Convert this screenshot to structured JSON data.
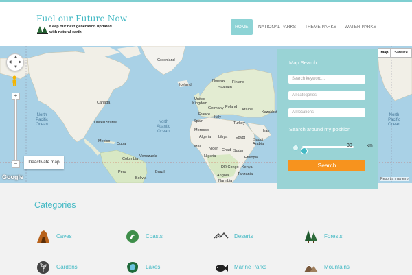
{
  "header": {
    "logo_title": "Fuel our Future Now",
    "tagline": "Keep our next generation updated with natural earth"
  },
  "nav": {
    "items": [
      {
        "label": "HOME",
        "active": true
      },
      {
        "label": "NATIONAL PARKS",
        "active": false
      },
      {
        "label": "THEME PARKS",
        "active": false
      },
      {
        "label": "WATER PARKS",
        "active": false
      }
    ]
  },
  "map": {
    "map_type_buttons": [
      "Map",
      "Satellite"
    ],
    "deactivate_label": "Deactivate map",
    "google_label": "Google",
    "report_label": "Report a map error",
    "labels": {
      "greenland": "Greenland",
      "iceland": "Iceland",
      "canada": "Canada",
      "united_states": "United States",
      "mexico": "Mexico",
      "cuba": "Cuba",
      "venezuela": "Venezuela",
      "colombia": "Colombia",
      "peru": "Peru",
      "brazil": "Brazil",
      "bolivia": "Bolivia",
      "norway": "Norway",
      "sweden": "Sweden",
      "finland": "Finland",
      "united_kingdom": "United Kingdom",
      "germany": "Germany",
      "poland": "Poland",
      "ukraine": "Ukraine",
      "france": "France",
      "spain": "Spain",
      "italy": "Italy",
      "turkey": "Turkey",
      "kazakhstan": "Kazakhstan",
      "iran": "Iran",
      "morocco": "Morocco",
      "algeria": "Algeria",
      "libya": "Libya",
      "egypt": "Egypt",
      "saudi_arabia": "Saudi Arabia",
      "mali": "Mali",
      "niger": "Niger",
      "chad": "Chad",
      "sudan": "Sudan",
      "ethiopia": "Ethiopia",
      "nigeria": "Nigeria",
      "drc": "DR Congo",
      "kenya": "Kenya",
      "tanzania": "Tanzania",
      "angola": "Angola",
      "namibia": "Namibia",
      "north_pacific": "North Pacific Ocean",
      "north_atlantic": "North Atlantic Ocean",
      "north_pacific_right": "North Pacific Ocean"
    }
  },
  "search": {
    "title": "Map Search",
    "keyword_placeholder": "Search keyword...",
    "categories_placeholder": "All categories",
    "locations_placeholder": "All locations",
    "around_label": "Search around my position",
    "radius_value": "30",
    "radius_unit": "km",
    "button_label": "Search"
  },
  "categories": {
    "title": "Categories",
    "items": [
      {
        "label": "Caves",
        "icon": "cave-icon"
      },
      {
        "label": "Coasts",
        "icon": "coast-icon"
      },
      {
        "label": "Deserts",
        "icon": "desert-icon"
      },
      {
        "label": "Forests",
        "icon": "forest-icon"
      },
      {
        "label": "Gardens",
        "icon": "garden-icon"
      },
      {
        "label": "Lakes",
        "icon": "lake-icon"
      },
      {
        "label": "Marine Parks",
        "icon": "fish-icon"
      },
      {
        "label": "Mountains",
        "icon": "mountain-icon"
      }
    ]
  },
  "colors": {
    "accent": "#43b9c4",
    "panel": "#99d3d5",
    "button": "#f7931e",
    "land": "#f1efe7",
    "water": "#a9d1e6"
  }
}
